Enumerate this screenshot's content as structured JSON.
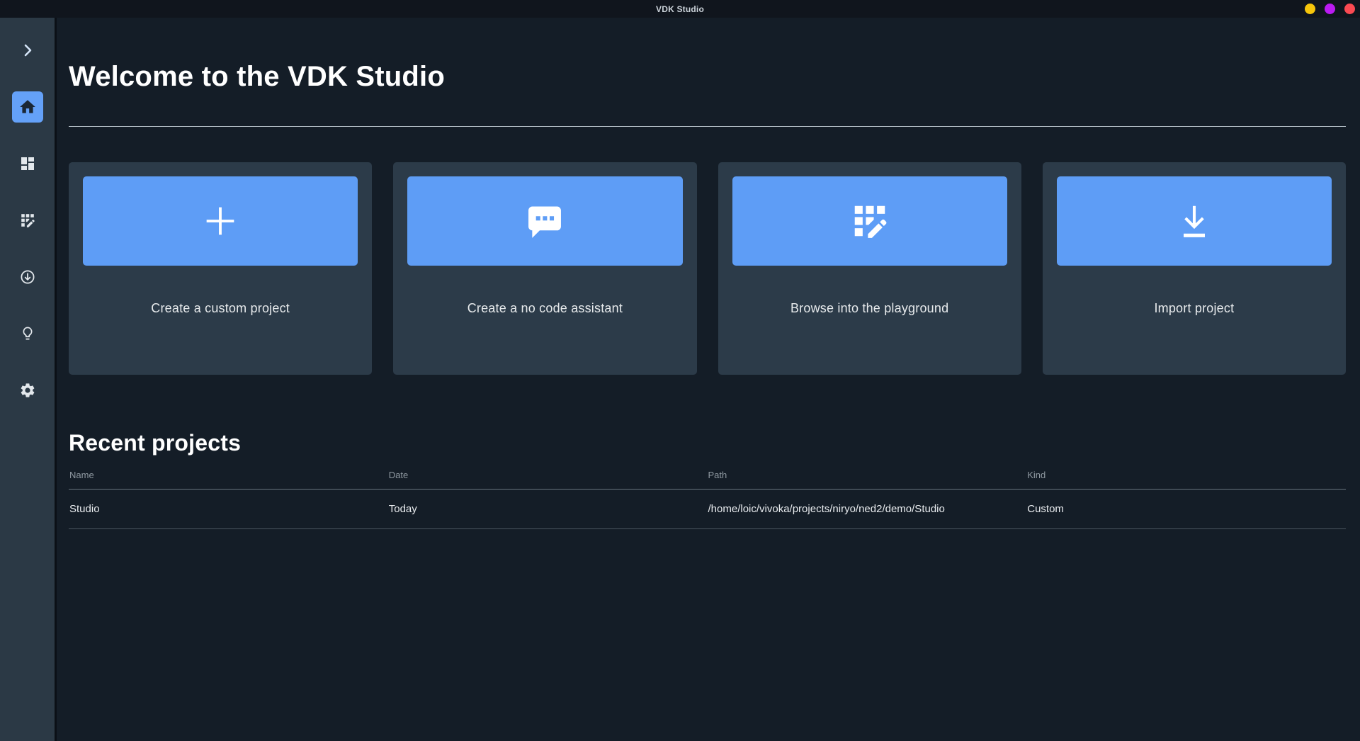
{
  "titlebar": {
    "title": "VDK Studio",
    "controls": [
      {
        "name": "minimize",
        "color": "#f6c50b"
      },
      {
        "name": "maximize",
        "color": "#bb1bf1"
      },
      {
        "name": "close",
        "color": "#fb4a52"
      }
    ]
  },
  "sidebar": {
    "items": [
      {
        "id": "expand",
        "icon": "chevron-right-icon",
        "active": false
      },
      {
        "id": "home",
        "icon": "home-icon",
        "active": true
      },
      {
        "id": "dashboard",
        "icon": "dashboard-icon",
        "active": false
      },
      {
        "id": "playground",
        "icon": "grid-edit-icon",
        "active": false
      },
      {
        "id": "downloads",
        "icon": "arrow-circle-down-icon",
        "active": false
      },
      {
        "id": "ideas",
        "icon": "lightbulb-icon",
        "active": false
      },
      {
        "id": "settings",
        "icon": "gear-icon",
        "active": false
      }
    ]
  },
  "main": {
    "welcome_title": "Welcome to the VDK Studio",
    "cards": [
      {
        "icon": "plus-icon",
        "label": "Create a custom project"
      },
      {
        "icon": "chat-bubble-icon",
        "label": "Create a no code assistant"
      },
      {
        "icon": "grid-edit-icon",
        "label": "Browse into the playground"
      },
      {
        "icon": "download-icon",
        "label": "Import project"
      }
    ],
    "recent": {
      "title": "Recent projects",
      "columns": [
        "Name",
        "Date",
        "Path",
        "Kind"
      ],
      "rows": [
        {
          "name": "Studio",
          "date": "Today",
          "path": "/home/loic/vivoka/projects/niryo/ned2/demo/Studio",
          "kind": "Custom"
        }
      ]
    }
  },
  "colors": {
    "accent_blue": "#5e9df6",
    "content_bg": "#141d27",
    "sidebar_bg": "#2b3945",
    "card_bg": "#2c3b49",
    "titlebar_bg": "#10151d"
  }
}
